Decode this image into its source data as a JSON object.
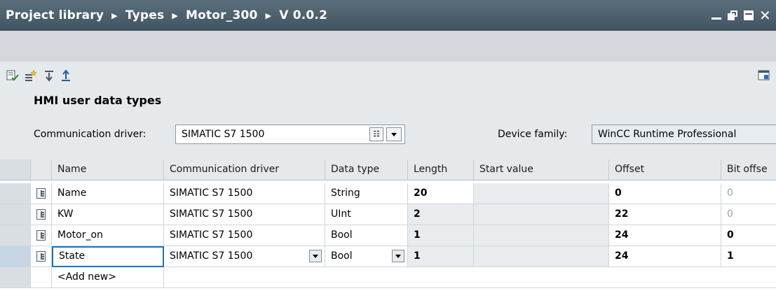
{
  "titlebar": {
    "breadcrumb": [
      "Project library",
      "Types",
      "Motor_300",
      "V 0.0.2"
    ],
    "separator": "▶",
    "close_glyph": "✕"
  },
  "toolbar": {
    "icons": [
      "apply-changes-icon",
      "new-item-icon",
      "download-icon",
      "upload-icon"
    ],
    "right_icon": "window-settings-icon"
  },
  "heading": "HMI user data types",
  "driver": {
    "label": "Communication driver:",
    "value": "SIMATIC S7 1500",
    "list_glyph": "☷"
  },
  "device": {
    "label": "Device family:",
    "value": "WinCC Runtime Professional"
  },
  "table": {
    "columns": [
      "Name",
      "Communication driver",
      "Data type",
      "Length",
      "Start value",
      "Offset",
      "Bit offse"
    ],
    "rows": [
      {
        "name": "Name",
        "driver": "SIMATIC S7 1500",
        "type": "String",
        "length": "20",
        "start": "",
        "offset": "0",
        "bit": "0"
      },
      {
        "name": "KW",
        "driver": "SIMATIC S7 1500",
        "type": "UInt",
        "length": "2",
        "start": "",
        "offset": "22",
        "bit": "0"
      },
      {
        "name": "Motor_on",
        "driver": "SIMATIC S7 1500",
        "type": "Bool",
        "length": "1",
        "start": "",
        "offset": "24",
        "bit": "0"
      },
      {
        "name": "State",
        "driver": "SIMATIC S7 1500",
        "type": "Bool",
        "length": "1",
        "start": "",
        "offset": "24",
        "bit": "1"
      }
    ],
    "add_new": "<Add new>"
  },
  "colors": {
    "titlebar": "#4a5e6c",
    "panel": "#e6e9ec",
    "selection": "#1a73c8"
  }
}
